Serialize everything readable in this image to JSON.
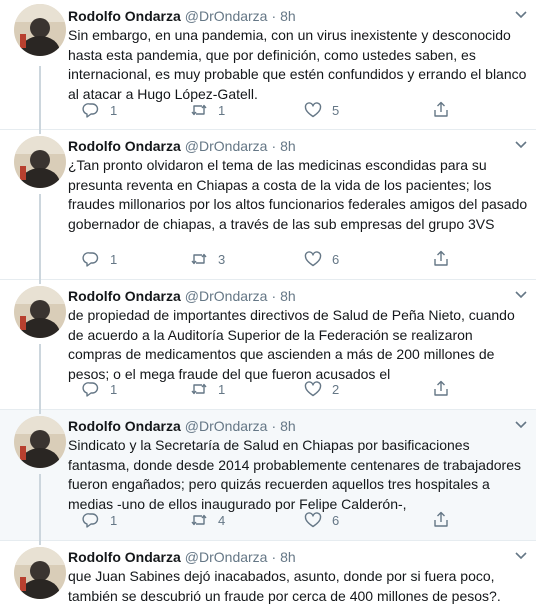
{
  "tweets": [
    {
      "name": "Rodolfo Ondarza",
      "handle": "@DrOndarza",
      "dot": "·",
      "time": "8h",
      "text": "Sin embargo, en una pandemia, con un virus inexistente y desconocido hasta esta pandemia, que por definición, como ustedes saben, es internacional, es muy probable que estén confundidos y errando el blanco al atacar a Hugo López-Gatell.",
      "replies": "1",
      "retweets": "1",
      "likes": "5"
    },
    {
      "name": "Rodolfo Ondarza",
      "handle": "@DrOndarza",
      "dot": "·",
      "time": "8h",
      "text": "¿Tan pronto olvidaron el tema de las medicinas escondidas para su presunta reventa en Chiapas a costa de la vida de los pacientes; los fraudes millonarios por los altos funcionarios federales amigos del pasado gobernador de chiapas, a través de las sub empresas del grupo 3VS",
      "replies": "1",
      "retweets": "3",
      "likes": "6"
    },
    {
      "name": "Rodolfo Ondarza",
      "handle": "@DrOndarza",
      "dot": "·",
      "time": "8h",
      "text": "de propiedad de importantes directivos de Salud de Peña Nieto, cuando de acuerdo a la Auditoría Superior de la Federación se realizaron compras de medicamentos que ascienden a más de 200 millones de pesos; o el mega fraude del que fueron acusados el",
      "replies": "1",
      "retweets": "1",
      "likes": "2"
    },
    {
      "name": "Rodolfo Ondarza",
      "handle": "@DrOndarza",
      "dot": "·",
      "time": "8h",
      "text": "Sindicato y la Secretaría de Salud en Chiapas por basificaciones fantasma, donde desde 2014 probablemente centenares de trabajadores fueron engañados; pero quizás recuerden aquellos tres hospitales a medias -uno de ellos  inaugurado por Felipe Calderón-,",
      "replies": "1",
      "retweets": "4",
      "likes": "6"
    },
    {
      "name": "Rodolfo Ondarza",
      "handle": "@DrOndarza",
      "dot": "·",
      "time": "8h",
      "text": "que Juan Sabines dejó inacabados, asunto, donde por si fuera poco, también se descubrió un fraude por cerca de 400 millones de pesos?."
    }
  ],
  "colors": {
    "text": "#14171a",
    "muted": "#657786",
    "divider": "#e6ecf0",
    "highlight_bg": "#f5f8fa",
    "thread_line": "#ccd6dd"
  },
  "icons": [
    "avatar",
    "caret-down-icon",
    "reply-icon",
    "retweet-icon",
    "like-icon",
    "share-icon"
  ]
}
